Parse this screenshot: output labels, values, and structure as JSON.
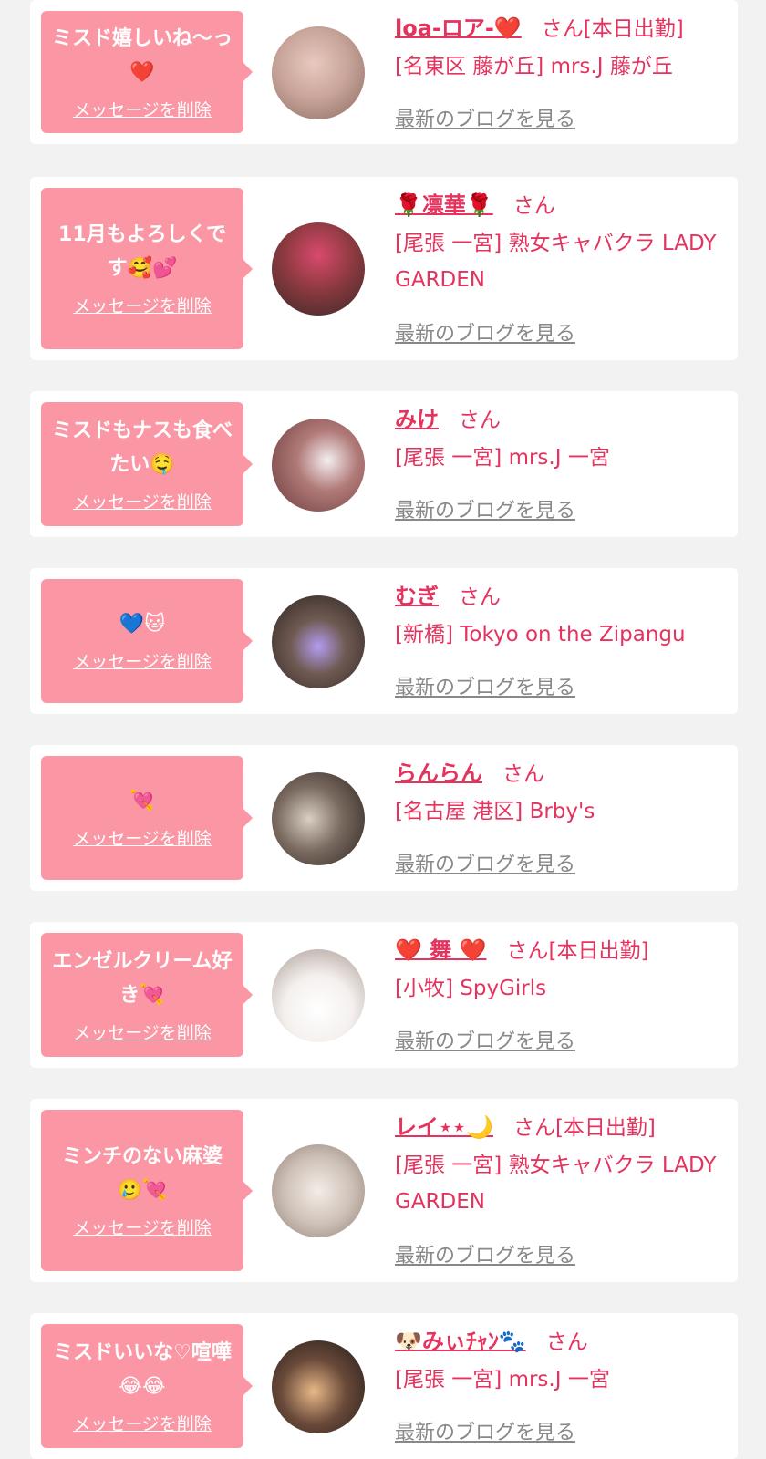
{
  "delete_label": "メッセージを削除",
  "blog_label": "最新のブログを見る",
  "colors": {
    "accent": "#e5335e",
    "bubble": "#fb96a4",
    "link_gray": "#888888",
    "background": "#f2f2f2"
  },
  "cards": [
    {
      "message": "ミスド嬉しいね〜っ❤️",
      "name": "loa-ロア-❤️",
      "suffix": "さん[本日出勤]",
      "shop": "[名東区 藤が丘] mrs.J 藤が丘"
    },
    {
      "message": "11月もよろしくです🥰💕",
      "name": "🌹凛華🌹",
      "suffix": "さん",
      "shop": "[尾張 一宮] 熟女キャバクラ LADY GARDEN"
    },
    {
      "message": "ミスドもナスも食べたい🤤",
      "name": "みけ",
      "suffix": "さん",
      "shop": "[尾張 一宮] mrs.J 一宮"
    },
    {
      "message": "💙🐱",
      "name": "むぎ",
      "suffix": "さん",
      "shop": "[新橋] Tokyo on the Zipangu"
    },
    {
      "message": "💘",
      "name": "らんらん",
      "suffix": "さん",
      "shop": "[名古屋 港区] Brby's"
    },
    {
      "message": "エンゼルクリーム好き💘",
      "name": "❤️ 舞 ❤️",
      "suffix": "さん[本日出勤]",
      "shop": "[小牧] SpyGirls"
    },
    {
      "message": "ミンチのない麻婆🥲💘",
      "name": "レイ⋆⋆🌙",
      "suffix": "さん[本日出勤]",
      "shop": "[尾張 一宮] 熟女キャバクラ LADY GARDEN"
    },
    {
      "message": "ミスドいいな♡喧嘩😂😂",
      "name": "🐶みぃﾁｬﾝ🐾",
      "suffix": "さん",
      "shop": "[尾張 一宮] mrs.J 一宮"
    }
  ]
}
